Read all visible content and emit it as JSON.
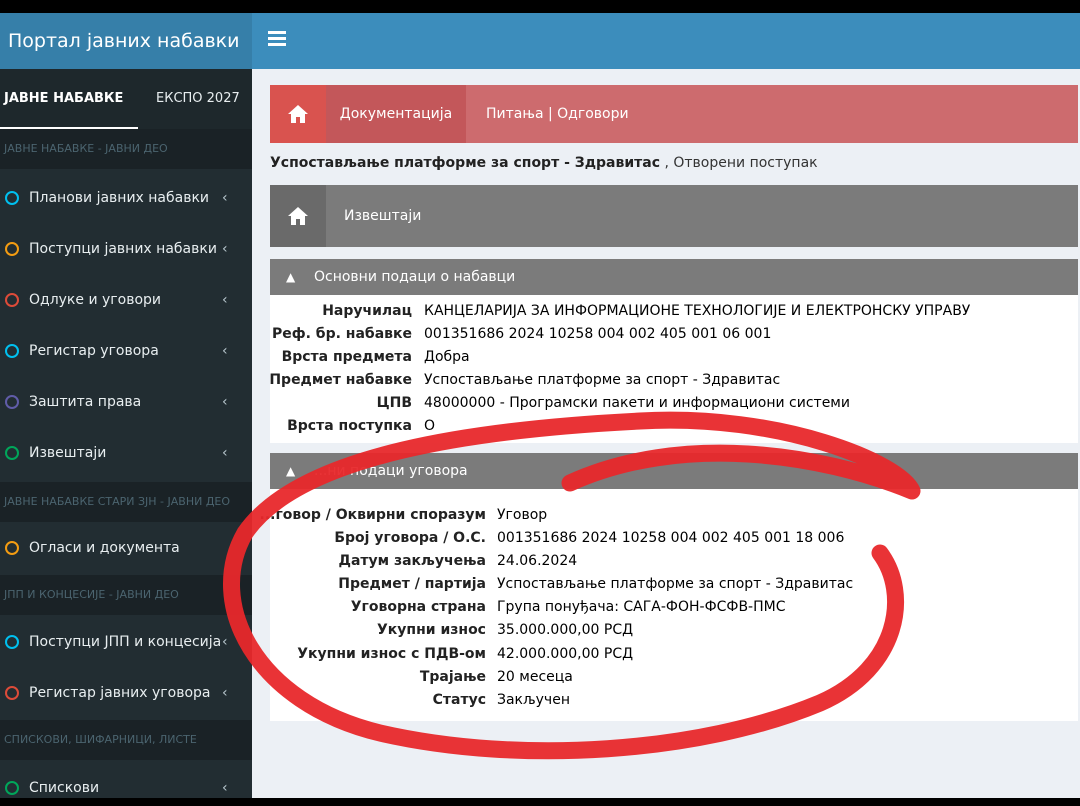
{
  "app": {
    "title": "Портал јавних набавки"
  },
  "sidebar": {
    "tabs": [
      "ЈАВНЕ НАБАВКЕ",
      "ЕКСПО 2027"
    ],
    "sections": [
      "ЈАВНЕ НАБАВКЕ - ЈАВНИ ДЕО",
      "ЈАВНЕ НАБАВКЕ СТАРИ ЗЈН - ЈАВНИ ДЕО",
      "ЈПП И КОНЦЕСИЈЕ - ЈАВНИ ДЕО",
      "СПИСКОВИ, ШИФАРНИЦИ, ЛИСТЕ"
    ],
    "items": [
      {
        "label": "Планови јавних набавки",
        "color": "#00c0ef"
      },
      {
        "label": "Поступци јавних набавки",
        "color": "#f39c12"
      },
      {
        "label": "Одлуке и уговори",
        "color": "#dd4b39"
      },
      {
        "label": "Регистар уговора",
        "color": "#00c0ef"
      },
      {
        "label": "Заштита права",
        "color": "#605ca8"
      },
      {
        "label": "Извештаји",
        "color": "#00a65a"
      },
      {
        "label": "Огласи и документа",
        "color": "#f39c12"
      },
      {
        "label": "Поступци ЈПП и концесија",
        "color": "#00c0ef"
      },
      {
        "label": "Регистар јавних уговора",
        "color": "#dd4b39"
      },
      {
        "label": "Спискови",
        "color": "#00a65a"
      }
    ],
    "chevron": "‹"
  },
  "tabs": {
    "documentation": "Документација",
    "qa": "Питања | Одговори"
  },
  "procedure": {
    "name": "Успостављање платформе за спорт - Здравитас",
    "type": ", Отворени поступак"
  },
  "reports": {
    "label": "Извештаји"
  },
  "basic": {
    "title": "Основни подаци о набавци",
    "rows": [
      {
        "k": "Наручилац",
        "v": "КАНЦЕЛАРИЈА ЗА ИНФОРМАЦИОНЕ ТЕХНОЛОГИЈЕ И ЕЛЕКТРОНСКУ УПРАВУ"
      },
      {
        "k": "Реф. бр. набавке",
        "v": "001351686 2024 10258 004 002 405 001 06 001"
      },
      {
        "k": "Врста предмета",
        "v": "Добра"
      },
      {
        "k": "Предмет набавке",
        "v": "Успостављање платформе за спорт - Здравитас"
      },
      {
        "k": "ЦПВ",
        "v": "48000000 - Програмски пакети и информациони системи"
      },
      {
        "k": "Врста поступка",
        "v": "О"
      }
    ]
  },
  "contract": {
    "title": "...ни подаци уговора",
    "rows": [
      {
        "k": "...говор / Оквирни споразум",
        "v": "Уговор"
      },
      {
        "k": "Број уговора / О.С.",
        "v": "001351686 2024 10258 004 002 405 001 18 006"
      },
      {
        "k": "Датум закључења",
        "v": "24.06.2024"
      },
      {
        "k": "Предмет / партија",
        "v": "Успостављање платформе за спорт - Здравитас"
      },
      {
        "k": "Уговорна страна",
        "v": "Група понуђача: САГА-ФОН-ФСФВ-ПМС"
      },
      {
        "k": "Укупни износ",
        "v": "35.000.000,00 РСД"
      },
      {
        "k": "Укупни износ с ПДВ-ом",
        "v": "42.000.000,00 РСД"
      },
      {
        "k": "Трајање",
        "v": "20 месеца"
      },
      {
        "k": "Статус",
        "v": "Закључен"
      }
    ]
  },
  "colors": {
    "topbar": "#3c8dbc",
    "docbar": "#cd6b6e",
    "annotation": "#e8282b"
  }
}
